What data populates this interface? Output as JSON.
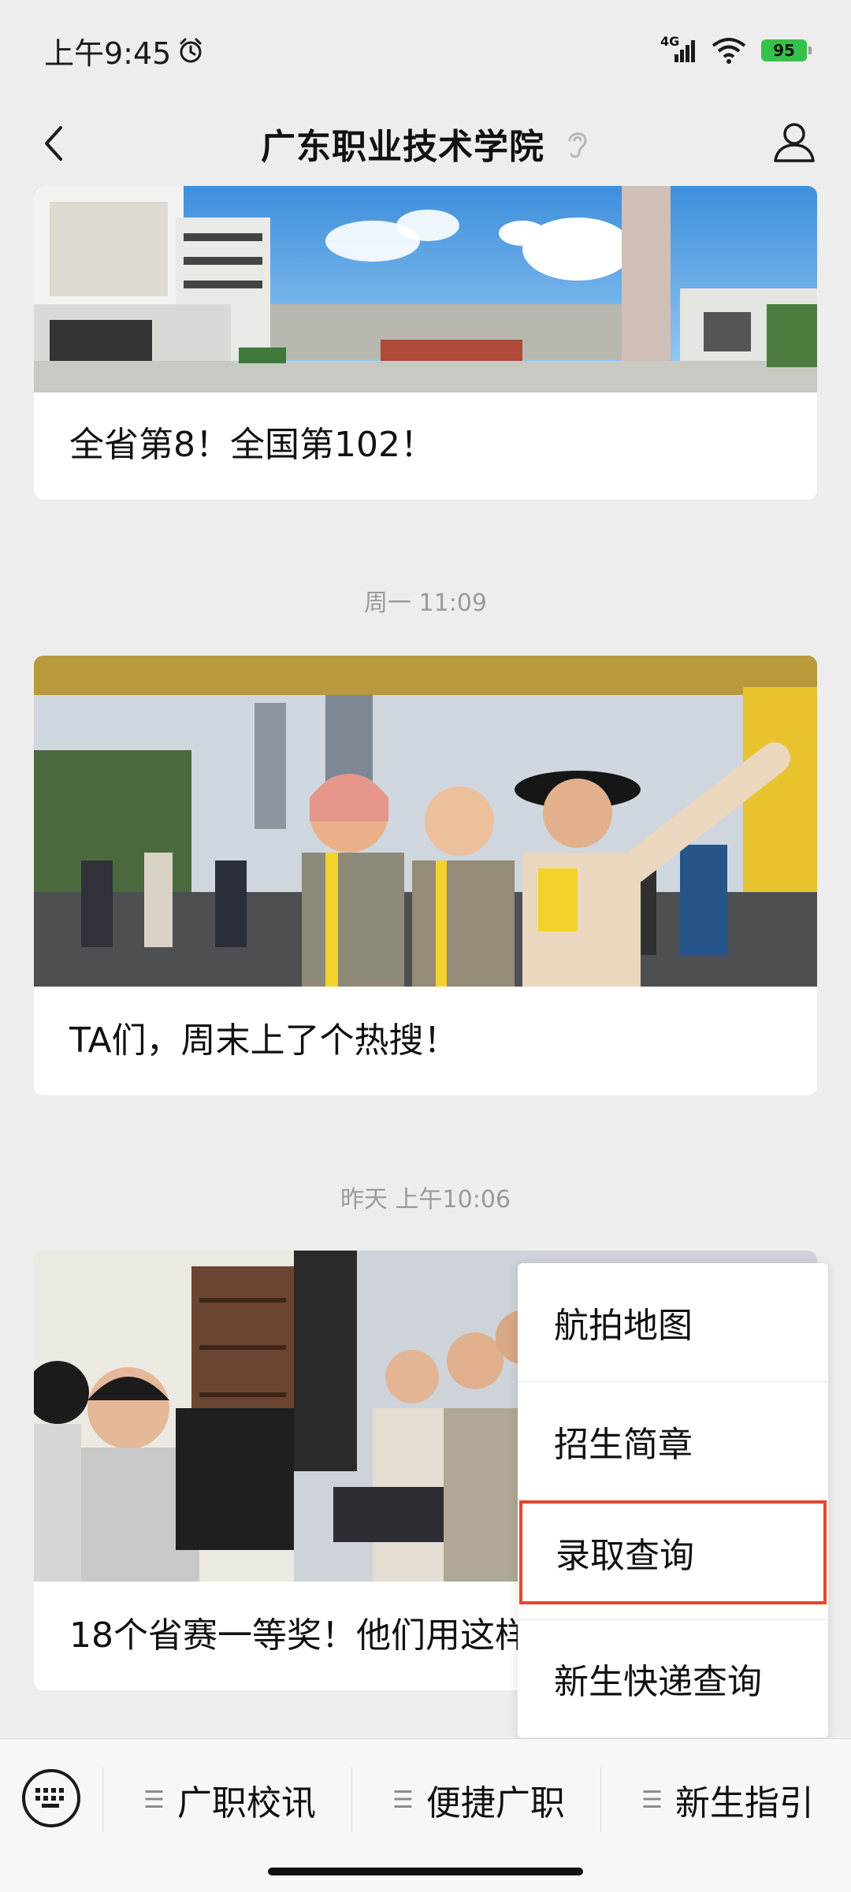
{
  "status_bar": {
    "time": "上午9:45",
    "network": "4G",
    "battery": "95"
  },
  "nav": {
    "title": "广东职业技术学院"
  },
  "feed": {
    "card1_title": "全省第8！全国第102！",
    "timestamp1": "周一 11:09",
    "card2_title": "TA们，周末上了个热搜！",
    "timestamp2": "昨天 上午10:06",
    "card3_title": "18个省赛一等奖！他们用这样"
  },
  "menu": {
    "items": [
      "航拍地图",
      "招生简章",
      "录取查询",
      "新生快递查询"
    ]
  },
  "bottom_tabs": {
    "items": [
      "广职校讯",
      "便捷广职",
      "新生指引"
    ]
  },
  "colors": {
    "highlight": "#e8452c",
    "battery": "#35c24a"
  }
}
